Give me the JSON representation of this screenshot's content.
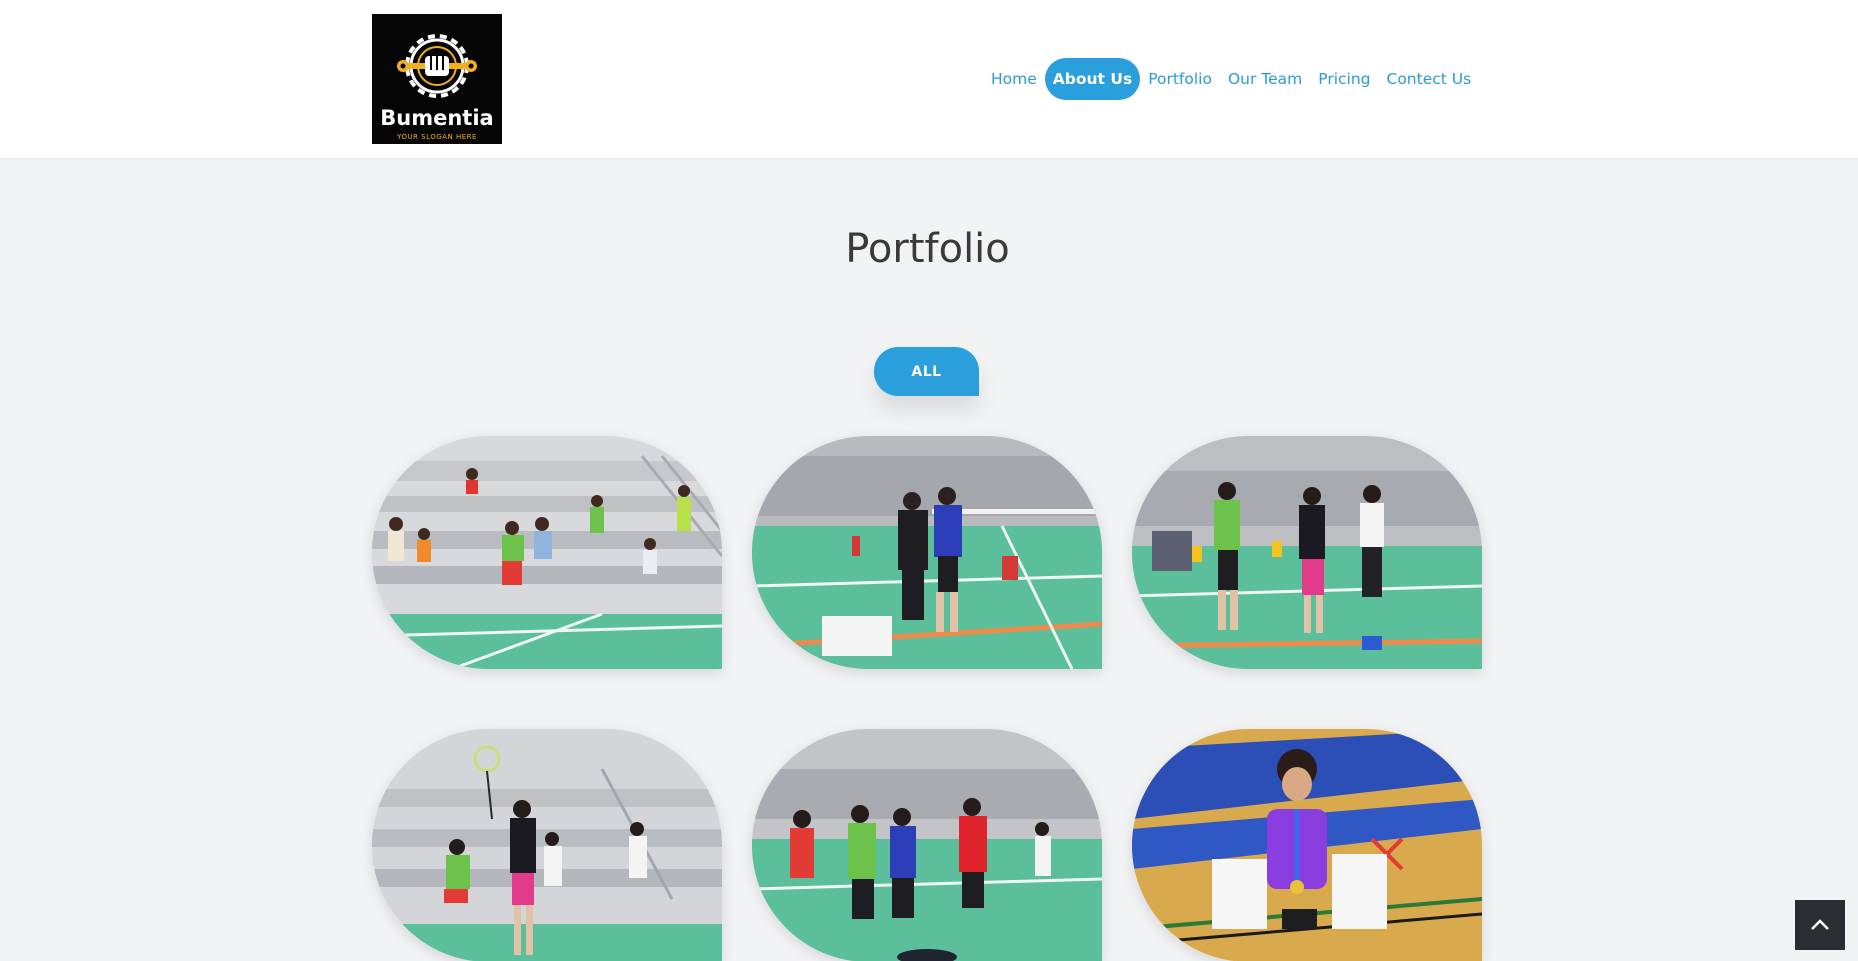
{
  "brand": {
    "name": "Bumentia",
    "slogan": "YOUR SLOGAN HERE",
    "icon": "gear-fist-wrench-logo"
  },
  "nav": {
    "items": [
      {
        "label": "Home",
        "active": false
      },
      {
        "label": "About Us",
        "active": true
      },
      {
        "label": "Portfolio",
        "active": false
      },
      {
        "label": "Our Team",
        "active": false
      },
      {
        "label": "Pricing",
        "active": false
      },
      {
        "label": "Contect Us",
        "active": false
      }
    ]
  },
  "portfolio": {
    "title": "Portfolio",
    "filters": [
      {
        "label": "ALL",
        "active": true
      }
    ],
    "items": [
      {
        "scene": "spectators-on-bleachers"
      },
      {
        "scene": "players-shaking-hands"
      },
      {
        "scene": "players-on-court"
      },
      {
        "scene": "player-smash"
      },
      {
        "scene": "players-greeting"
      },
      {
        "scene": "girl-with-medal-and-certificates"
      }
    ]
  },
  "back_to_top": {
    "icon": "chevron-up-icon"
  },
  "colors": {
    "accent": "#2b9fdc",
    "nav_text": "#2b9bd6",
    "page_background": "#f2f3f5",
    "court_green": "#5bbf9b",
    "back_to_top_bg": "#2a2d31"
  }
}
